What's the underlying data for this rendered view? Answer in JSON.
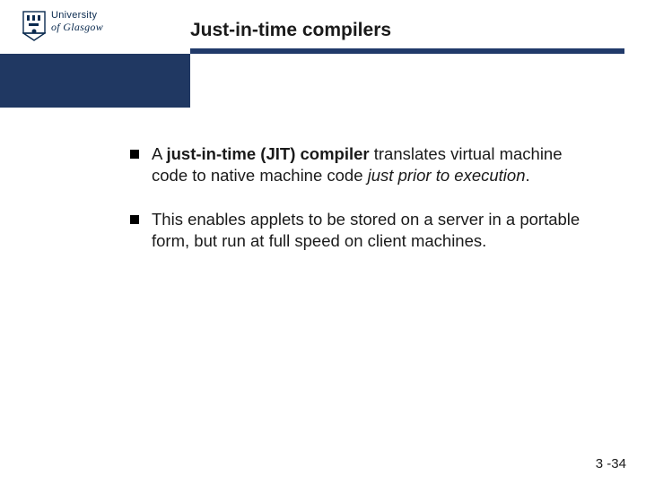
{
  "header": {
    "logo": {
      "line1": "University",
      "line2": "of Glasgow"
    },
    "title": "Just-in-time compilers"
  },
  "content": {
    "bullets": [
      {
        "pre": "A ",
        "bold": "just-in-time (JIT) compiler",
        "mid": " translates virtual machine code to native machine code ",
        "italic": "just prior to execution",
        "post": "."
      },
      {
        "text": "This enables applets to be stored on a server in a portable form, but run at full speed on client machines."
      }
    ]
  },
  "footer": {
    "page": "3 -34"
  }
}
